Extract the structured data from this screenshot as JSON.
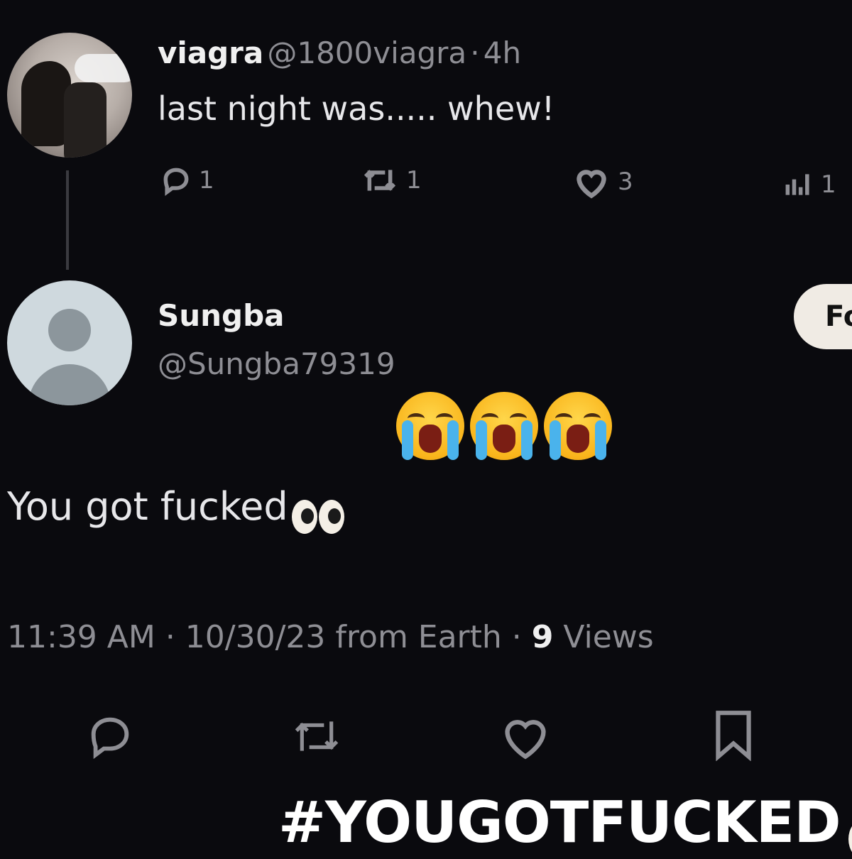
{
  "parent_tweet": {
    "display_name": "viagra",
    "handle": "@1800viagra",
    "separator": "·",
    "time": "4h",
    "text": "last night was..... whew!",
    "actions": {
      "reply_count": "1",
      "retweet_count": "1",
      "like_count": "3",
      "views_count": "1"
    }
  },
  "reply_tweet": {
    "display_name": "Sungba",
    "handle": "@Sungba79319",
    "follow_label": "Fo",
    "text": "You got fucked",
    "timestamp": "11:39 AM · 10/30/23 from Earth · ",
    "views_number": "9",
    "views_label": " Views"
  },
  "overlay": {
    "hashtag": "#YOUGOTFUCKED"
  },
  "colors": {
    "background": "#0a0a0e",
    "secondary_text": "#8e8e94",
    "follow_button": "#f0ebe4"
  }
}
